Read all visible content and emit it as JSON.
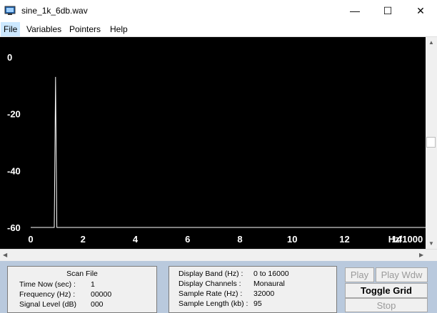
{
  "window": {
    "title": "sine_1k_6db.wav",
    "minimize": "—",
    "maximize": "☐",
    "close": "✕"
  },
  "menu": [
    "File",
    "Variables",
    "Pointers",
    "Help"
  ],
  "chart_data": {
    "type": "line",
    "y_ticks": [
      "0",
      "-20",
      "-40",
      "-60"
    ],
    "x_ticks": [
      "0",
      "2",
      "4",
      "6",
      "8",
      "10",
      "12",
      "14"
    ],
    "x_unit_label": "Hz/1000",
    "xlim": [
      0,
      15.1
    ],
    "ylim": [
      -60,
      0
    ],
    "grid": false,
    "series": [
      {
        "x": [
          0.0,
          0.9,
          0.95,
          1.0,
          1.05,
          1.1,
          15.1
        ],
        "y": [
          -60,
          -60,
          -7,
          -60,
          -60,
          -60,
          -60
        ]
      }
    ],
    "colors": {
      "background": "#000000",
      "trace": "#ffffff"
    }
  },
  "scan_panel": {
    "heading": "Scan File",
    "rows": [
      {
        "label": "Time Now (sec) :",
        "value": "1"
      },
      {
        "label": "Frequency (Hz) :",
        "value": "00000"
      },
      {
        "label": "Signal Level (dB)",
        "value": "000"
      }
    ]
  },
  "info_panel": {
    "rows": [
      {
        "label": "Display Band (Hz) :",
        "value": "0 to 16000"
      },
      {
        "label": "Display Channels :",
        "value": "Monaural"
      },
      {
        "label": "Sample Rate (Hz) :",
        "value": "32000"
      },
      {
        "label": "Sample Length (kb) :",
        "value": "95"
      }
    ]
  },
  "buttons": {
    "play": "Play",
    "play_wdw": "Play Wdw",
    "toggle_grid": "Toggle Grid",
    "stop": "Stop"
  }
}
